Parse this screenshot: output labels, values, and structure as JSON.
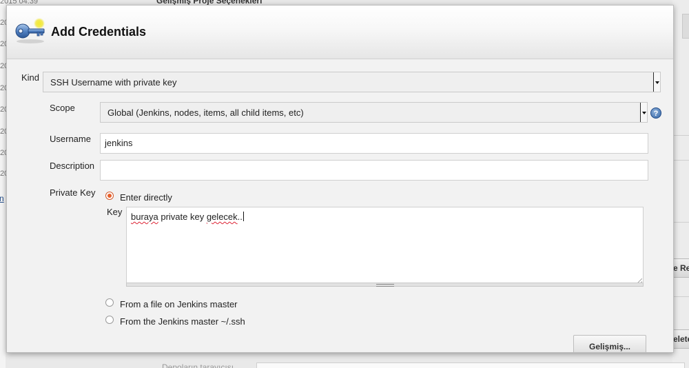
{
  "background": {
    "timestamp_partial": "2015 04:39",
    "row_prefix": "20",
    "section_heading": "Gelişmiş Proje Seçenekleri",
    "link_partial": "n",
    "right_button_1": "e Re",
    "right_button_2": "elete",
    "bottom_label": "Depoların tarayıcısı"
  },
  "dialog": {
    "title": "Add Credentials",
    "icon": "key-icon",
    "kind": {
      "label": "Kind",
      "selected": "SSH Username with private key"
    },
    "scope": {
      "label": "Scope",
      "selected": "Global (Jenkins, nodes, items, all child items, etc)",
      "help_icon": "help-icon",
      "help_glyph": "?"
    },
    "username": {
      "label": "Username",
      "value": "jenkins"
    },
    "description": {
      "label": "Description",
      "value": ""
    },
    "private_key": {
      "label": "Private Key",
      "options": [
        {
          "label": "Enter directly",
          "checked": true
        },
        {
          "label": "From a file on Jenkins master",
          "checked": false
        },
        {
          "label": "From the Jenkins master ~/.ssh",
          "checked": false
        }
      ],
      "key_label": "Key",
      "key_value_word1": "buraya",
      "key_value_middle": " private key ",
      "key_value_word2": "gelecek",
      "key_value_tail": ".."
    },
    "advanced_button": "Gelişmiş..."
  },
  "colors": {
    "radio_checked": "#e8602c",
    "help_blue": "#3465a4",
    "link_blue": "#204a87"
  }
}
